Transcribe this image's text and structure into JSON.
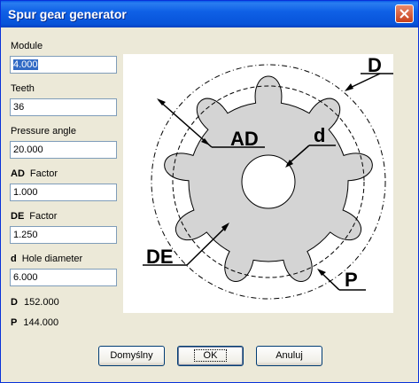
{
  "window": {
    "title": "Spur gear generator"
  },
  "fields": {
    "module": {
      "label": "Module",
      "value": "4.000"
    },
    "teeth": {
      "label": "Teeth",
      "value": "36"
    },
    "pressure_angle": {
      "label": "Pressure angle",
      "value": "20.000"
    },
    "ad_factor": {
      "bold": "AD",
      "label": "Factor",
      "value": "1.000"
    },
    "de_factor": {
      "bold": "DE",
      "label": "Factor",
      "value": "1.250"
    },
    "hole_diameter": {
      "bold": "d",
      "label": "Hole diameter",
      "value": "6.000"
    }
  },
  "readouts": {
    "d": {
      "bold": "D",
      "value": "152.000"
    },
    "p": {
      "bold": "P",
      "value": "144.000"
    }
  },
  "diagram": {
    "labels": {
      "D": "D",
      "AD": "AD",
      "d": "d",
      "DE": "DE",
      "P": "P"
    }
  },
  "buttons": {
    "default": "Domyślny",
    "ok": "OK",
    "cancel": "Anuluj"
  },
  "colors": {
    "titlebar": "#0a5ce8",
    "gear_fill": "#d4d4d4",
    "dialog_bg": "#ece9d8",
    "selection": "#316ac5"
  }
}
